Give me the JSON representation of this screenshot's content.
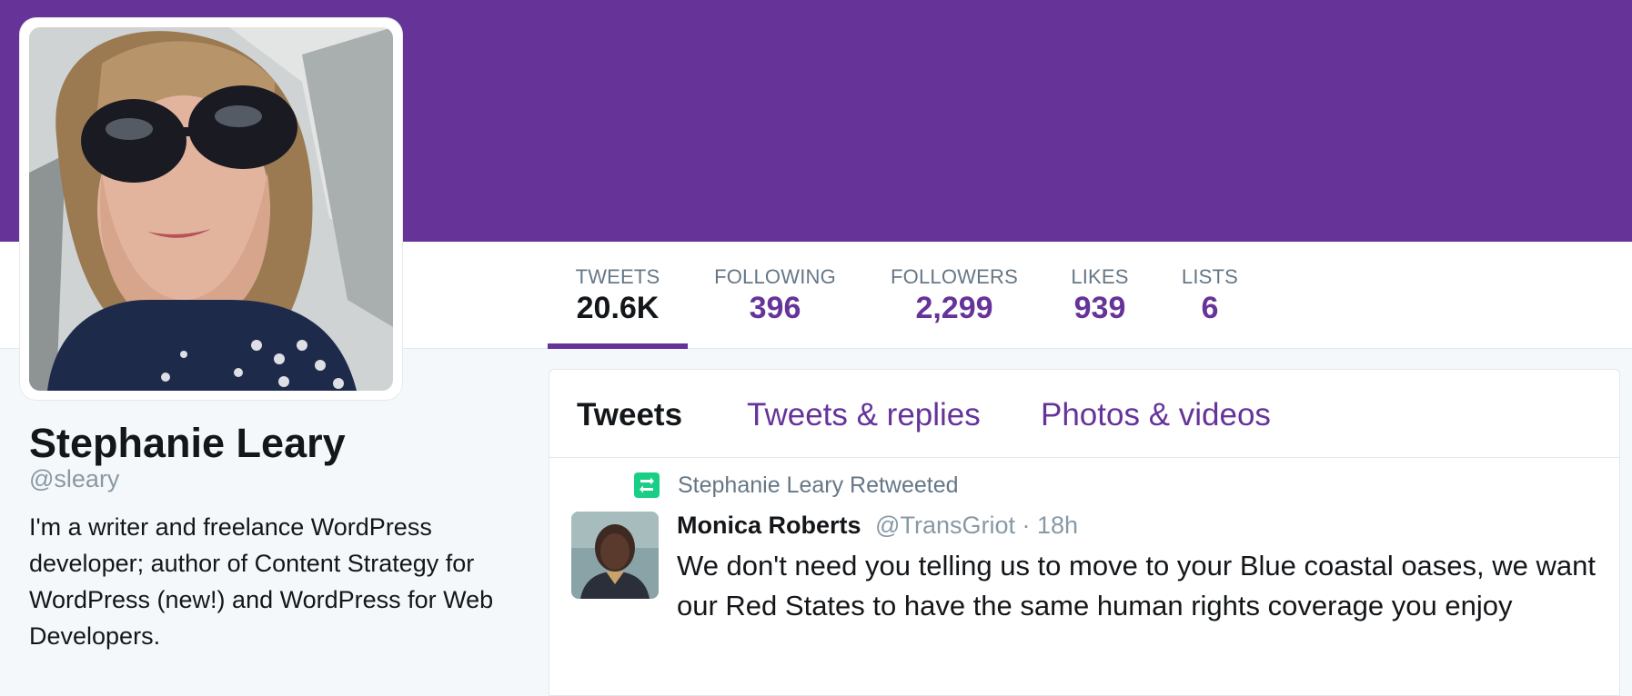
{
  "theme": {
    "accent": "#663399",
    "banner": "#663399",
    "retweet_green": "#19cf86",
    "text_primary": "#14171a",
    "text_secondary": "#657786"
  },
  "profile": {
    "name": "Stephanie Leary",
    "handle": "@sleary",
    "bio": "I'm a writer and freelance WordPress developer; author of Content Strategy for WordPress (new!) and WordPress for Web Developers."
  },
  "stats": [
    {
      "label": "TWEETS",
      "value": "20.6K",
      "active": true
    },
    {
      "label": "FOLLOWING",
      "value": "396",
      "active": false
    },
    {
      "label": "FOLLOWERS",
      "value": "2,299",
      "active": false
    },
    {
      "label": "LIKES",
      "value": "939",
      "active": false
    },
    {
      "label": "LISTS",
      "value": "6",
      "active": false
    }
  ],
  "timeline_tabs": [
    {
      "label": "Tweets",
      "active": true
    },
    {
      "label": "Tweets & replies",
      "active": false
    },
    {
      "label": "Photos & videos",
      "active": false
    }
  ],
  "tweet": {
    "context_icon": "retweet-icon",
    "context": "Stephanie Leary Retweeted",
    "author_name": "Monica Roberts",
    "author_handle": "@TransGriot",
    "separator": "·",
    "time": "18h",
    "text": "We don't need you telling us to move to your Blue coastal oases, we want our Red States to have the same human rights coverage you enjoy"
  }
}
